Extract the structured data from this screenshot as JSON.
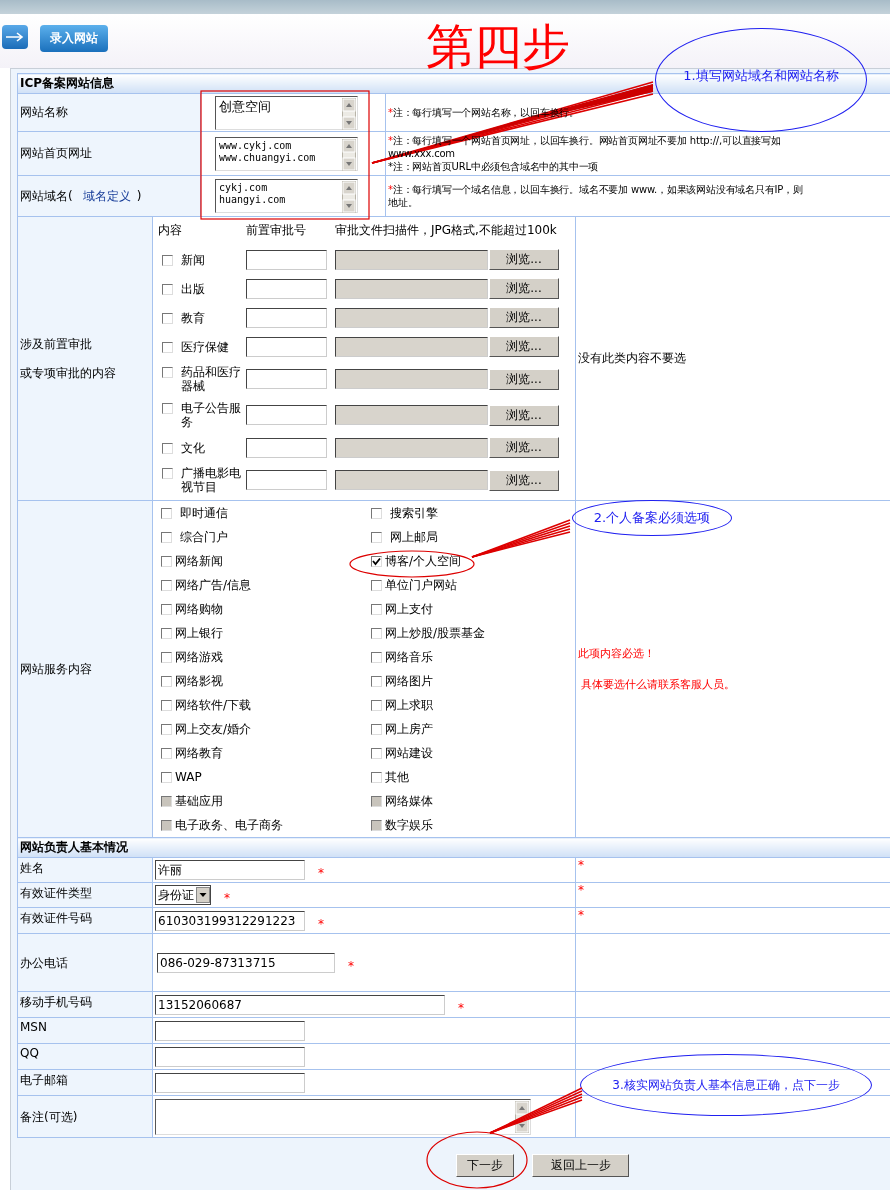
{
  "header": {
    "step_title": "第四步",
    "nav_button": "录入网站"
  },
  "site_section": {
    "title": "ICP备案网站信息",
    "rows": [
      {
        "label": "网站名称",
        "value": [
          "创意空间"
        ],
        "notes": [
          {
            "mark": "*",
            "mark_red": true,
            "lines": [
              "注：每行填写一个网站名称，以回车换行。"
            ]
          }
        ]
      },
      {
        "label": "网站首页网址",
        "value": [
          "www.cykj.com",
          "www.chuangyi.com"
        ],
        "notes": [
          {
            "mark": "*",
            "mark_red": true,
            "lines": [
              "注：每行填写一个网站首页网址，以回车换行。网站首页网址不要加 http://,可以直接写如",
              "www.xxx.com"
            ]
          },
          {
            "mark": "*",
            "mark_red": false,
            "lines": [
              "注：网站首页URL中必须包含域名中的其中一项"
            ]
          }
        ]
      },
      {
        "label": "网站域名(",
        "link": "域名定义",
        "label_end": ")",
        "value": [
          "cykj.com",
          "huangyi.com"
        ],
        "notes": [
          {
            "mark": "*",
            "mark_red": true,
            "lines": [
              "注：每行填写一个域名信息，以回车换行。域名不要加 www.，如果该网站没有域名只有IP，则",
              "地址。"
            ]
          }
        ]
      }
    ]
  },
  "approvals": {
    "label_lines": [
      "涉及前置审批",
      "或专项审批的内容"
    ],
    "columns": [
      "内容",
      "前置审批号",
      "审批文件扫描件，JPG格式,不能超过100k"
    ],
    "side_note": "没有此类内容不要选",
    "items": [
      {
        "label": "新闻",
        "checked": false,
        "button": "浏览..."
      },
      {
        "label": "出版",
        "checked": false,
        "button": "浏览..."
      },
      {
        "label": "教育",
        "checked": false,
        "button": "浏览..."
      },
      {
        "label": "医疗保健",
        "checked": false,
        "button": "浏览..."
      },
      {
        "label": "药品和医疗器械",
        "checked": false,
        "button": "浏览..."
      },
      {
        "label": "电子公告服务",
        "checked": false,
        "button": "浏览..."
      },
      {
        "label": "文化",
        "checked": false,
        "button": "浏览..."
      },
      {
        "label": "广播电影电视节目",
        "checked": false,
        "button": "浏览..."
      }
    ]
  },
  "services": {
    "label": "网站服务内容",
    "notes": [
      "此项内容必选！",
      "具体要选什么请联系客服人员。"
    ],
    "items": [
      {
        "label": "即时通信",
        "checked": false,
        "disabled": false
      },
      {
        "label": "搜索引擎",
        "checked": false,
        "disabled": false
      },
      {
        "label": "综合门户",
        "checked": false,
        "disabled": false
      },
      {
        "label": "网上邮局",
        "checked": false,
        "disabled": false
      },
      {
        "label": "网络新闻",
        "checked": false,
        "disabled": false
      },
      {
        "label": "博客/个人空间",
        "checked": true,
        "disabled": false
      },
      {
        "label": "网络广告/信息",
        "checked": false,
        "disabled": false
      },
      {
        "label": "单位门户网站",
        "checked": false,
        "disabled": false
      },
      {
        "label": "网络购物",
        "checked": false,
        "disabled": false
      },
      {
        "label": "网上支付",
        "checked": false,
        "disabled": false
      },
      {
        "label": "网上银行",
        "checked": false,
        "disabled": false
      },
      {
        "label": "网上炒股/股票基金",
        "checked": false,
        "disabled": false
      },
      {
        "label": "网络游戏",
        "checked": false,
        "disabled": false
      },
      {
        "label": "网络音乐",
        "checked": false,
        "disabled": false
      },
      {
        "label": "网络影视",
        "checked": false,
        "disabled": false
      },
      {
        "label": "网络图片",
        "checked": false,
        "disabled": false
      },
      {
        "label": "网络软件/下载",
        "checked": false,
        "disabled": false
      },
      {
        "label": "网上求职",
        "checked": false,
        "disabled": false
      },
      {
        "label": "网上交友/婚介",
        "checked": false,
        "disabled": false
      },
      {
        "label": "网上房产",
        "checked": false,
        "disabled": false
      },
      {
        "label": "网络教育",
        "checked": false,
        "disabled": false
      },
      {
        "label": "网站建设",
        "checked": false,
        "disabled": false
      },
      {
        "label": "WAP",
        "checked": false,
        "disabled": false
      },
      {
        "label": "其他",
        "checked": false,
        "disabled": false
      },
      {
        "label": "基础应用",
        "checked": false,
        "disabled": true
      },
      {
        "label": "网络媒体",
        "checked": false,
        "disabled": true
      },
      {
        "label": "电子政务、电子商务",
        "checked": false,
        "disabled": true
      },
      {
        "label": "数字娱乐",
        "checked": false,
        "disabled": true
      }
    ]
  },
  "person_section": {
    "title": "网站负责人基本情况",
    "fields": [
      {
        "label": "姓名",
        "kind": "input",
        "value": "许丽",
        "mark": "*",
        "side_mark": "*"
      },
      {
        "label": "有效证件类型",
        "kind": "select",
        "value": "身份证",
        "mark": "*",
        "side_mark": "*"
      },
      {
        "label": "有效证件号码",
        "kind": "input",
        "value": "610303199312291223",
        "mark": "*",
        "side_mark": "*"
      },
      {
        "label": "办公电话",
        "kind": "input",
        "value": "086-029-87313715",
        "mark": "*"
      },
      {
        "label": "移动手机号码",
        "kind": "input",
        "value": "13152060687",
        "mark": "*"
      },
      {
        "label": "MSN",
        "kind": "input"
      },
      {
        "label": "QQ",
        "kind": "input"
      },
      {
        "label": "电子邮箱",
        "kind": "input"
      },
      {
        "label": "备注(可选)",
        "kind": "textarea"
      }
    ]
  },
  "buttons": [
    {
      "label": "下一步",
      "kind": "next"
    },
    {
      "label": "返回上一步",
      "kind": "back"
    }
  ],
  "callouts": [
    "1.填写网站域名和网站名称",
    "2.个人备案必须选项",
    "3.核实网站负责人基本信息正确，点下一步"
  ]
}
